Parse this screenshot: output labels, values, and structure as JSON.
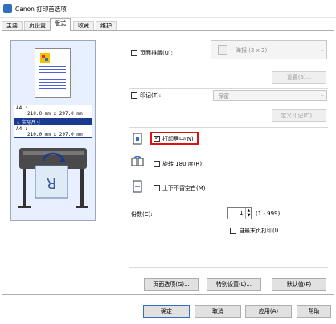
{
  "window": {
    "title": "Canon 打印首选项"
  },
  "tabs": [
    {
      "label": "主要"
    },
    {
      "label": "页设置"
    },
    {
      "label": "版式"
    },
    {
      "label": "收藏"
    },
    {
      "label": "维护"
    }
  ],
  "preview": {
    "paper_line1": "A4 :",
    "paper_line2": "210.0 mm x 297.0 mm",
    "selected": "↓ 实际尺寸",
    "paper_line3": "A4 :",
    "paper_line4": "210.0 mm x 297.0 mm"
  },
  "layout": {
    "page_layout_label": "页面排版(U):",
    "page_layout_value": "海报 (2 x 2)",
    "page_layout_checked": false,
    "settings_button": "设置(S)...",
    "stamp_label": "印记(T):",
    "stamp_value": "保密",
    "stamp_checked": false,
    "define_stamp_button": "定义印记(D)...",
    "center_label": "打印居中(N)",
    "center_checked": true,
    "rotate_label": "旋转 180 度(R)",
    "rotate_checked": false,
    "no_margin_label": "上下不留空白(M)",
    "no_margin_checked": false
  },
  "copies": {
    "label": "份数(C):",
    "value": "1",
    "range": "(1 - 999)",
    "last_page_first_label": "自最末页打印(I)",
    "last_page_first_checked": false
  },
  "bottom_buttons": {
    "page_options": "页面选项(G)...",
    "special_settings": "特别设置(L)...",
    "defaults": "默认值(F)"
  },
  "dialog_buttons": {
    "ok": "确定",
    "cancel": "取消",
    "apply": "应用(A)",
    "help": "帮助"
  }
}
